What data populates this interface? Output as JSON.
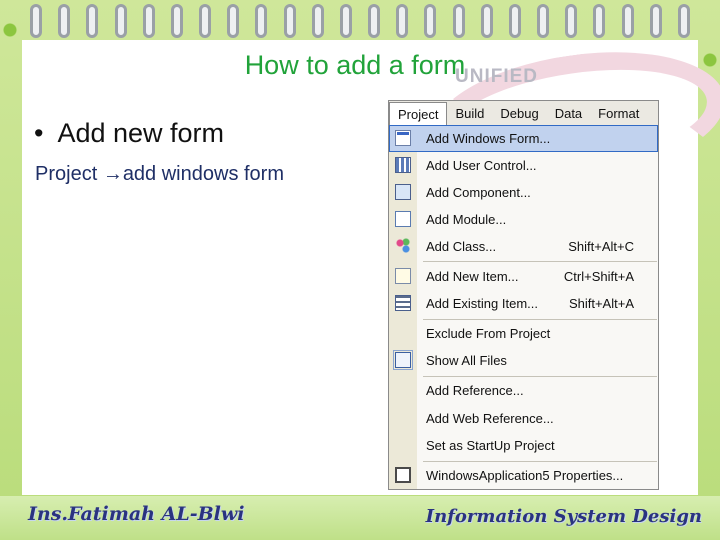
{
  "slide": {
    "title": "How to add a form",
    "bullet": "Add new form",
    "path_prefix": "Project ",
    "path_arrow": "→",
    "path_suffix": "add windows form",
    "watermark": "UNIFIED",
    "footer_left": "Ins.Fatimah AL-Blwi",
    "footer_right": "Information System Design"
  },
  "menu": {
    "menubar": [
      "Project",
      "Build",
      "Debug",
      "Data",
      "Format"
    ],
    "items": [
      {
        "label": "Add Windows Form...",
        "shortcut": "",
        "icon": "form-icon"
      },
      {
        "label": "Add User Control...",
        "shortcut": "",
        "icon": "user-control-icon"
      },
      {
        "label": "Add Component...",
        "shortcut": "",
        "icon": "component-icon"
      },
      {
        "label": "Add Module...",
        "shortcut": "",
        "icon": "module-icon"
      },
      {
        "label": "Add Class...",
        "shortcut": "Shift+Alt+C",
        "icon": "class-icon"
      },
      {
        "label": "Add New Item...",
        "shortcut": "Ctrl+Shift+A",
        "icon": "new-item-icon"
      },
      {
        "label": "Add Existing Item...",
        "shortcut": "Shift+Alt+A",
        "icon": "existing-item-icon"
      },
      {
        "label": "Exclude From Project",
        "shortcut": "",
        "icon": ""
      },
      {
        "label": "Show All Files",
        "shortcut": "",
        "icon": "show-all-files-icon"
      },
      {
        "label": "Add Reference...",
        "shortcut": "",
        "icon": ""
      },
      {
        "label": "Add Web Reference...",
        "shortcut": "",
        "icon": ""
      },
      {
        "label": "Set as StartUp Project",
        "shortcut": "",
        "icon": ""
      },
      {
        "label": "WindowsApplication5 Properties...",
        "shortcut": "",
        "icon": "properties-icon"
      }
    ]
  }
}
